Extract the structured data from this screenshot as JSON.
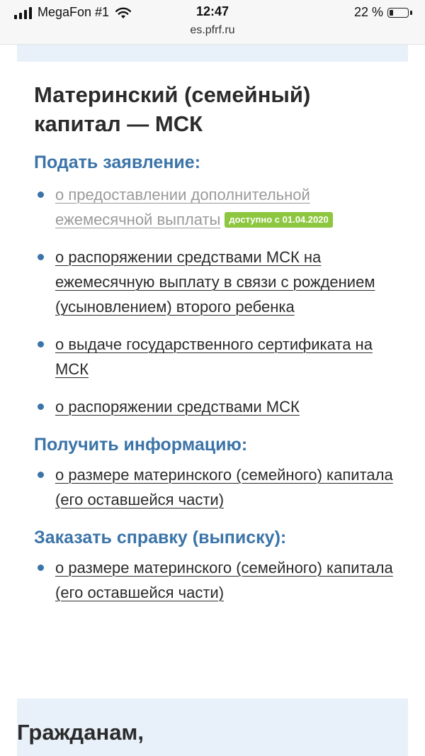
{
  "status_bar": {
    "carrier": "MegaFon #1",
    "time": "12:47",
    "url": "es.pfrf.ru",
    "battery": "22 %",
    "battery_level_percent": 22,
    "icons": [
      "signal-icon",
      "wifi-icon",
      "battery-icon"
    ]
  },
  "page": {
    "title": "Материнский (семейный) капитал — МСК",
    "sections": {
      "apply": {
        "heading": "Подать заявление:",
        "items": [
          {
            "label": "о предоставлении дополнительной ежемесячной выплаты",
            "badge": "доступно с 01.04.2020"
          },
          {
            "label": "о распоряжении средствами МСК на ежемесячную выплату в связи с рождением (усыновлением) второго ребенка"
          },
          {
            "label": "о выдаче государственного сертификата на МСК"
          },
          {
            "label": "о распоряжении средствами МСК"
          }
        ]
      },
      "info": {
        "heading": "Получить информацию:",
        "items": [
          {
            "label": "о размере материнского (семейного) капитала (его оставшейся части)"
          }
        ]
      },
      "certificate": {
        "heading": "Заказать справку (выписку):",
        "items": [
          {
            "label": "о размере материнского (семейного) капитала (его оставшейся части)"
          }
        ]
      }
    },
    "next_section_title": "Гражданам,"
  },
  "colors": {
    "accent": "#3b74a8",
    "text": "#2b2b2b",
    "disabled": "#9a9a9a",
    "badge": "#8dc63f",
    "band": "#e8f0f9"
  }
}
